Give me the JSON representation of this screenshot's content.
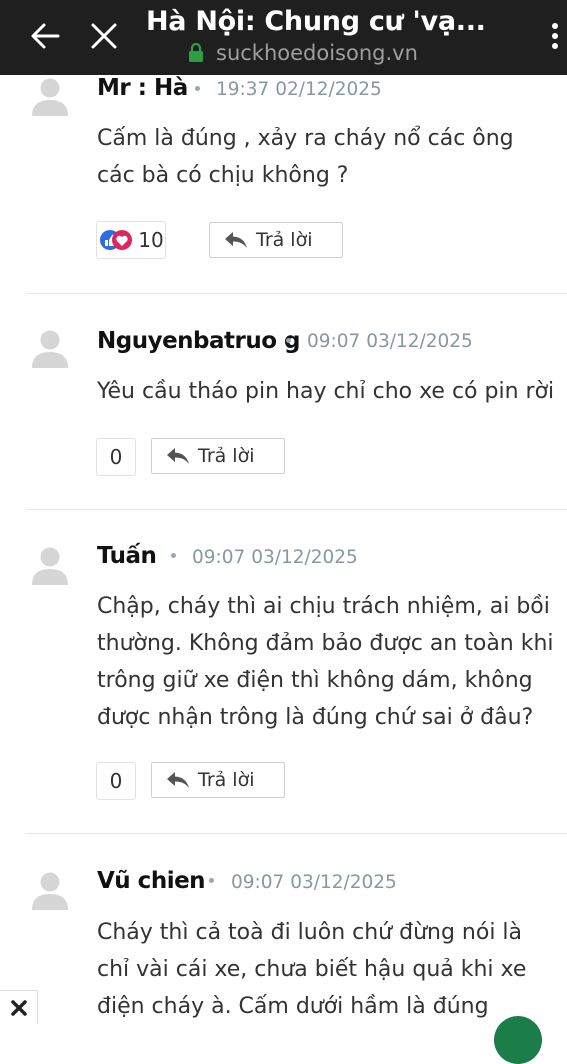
{
  "topbar": {
    "title": "Hà Nội: Chung cư 'vạ...",
    "url": "suckhoedoisong.vn",
    "back_icon": "arrow-left-icon",
    "close_icon": "close-icon",
    "menu_icon": "more-vert-icon",
    "lock_color": "#2e9e44"
  },
  "comments": [
    {
      "name": "Mr : Hà",
      "time": "19:37 02/12/2025",
      "text": "Cấm là đúng , xảy ra cháy nổ các ông các bà có chịu không ?",
      "reactions": "10",
      "reply": "Trả lời"
    },
    {
      "name": "Nguyenbatruo g",
      "time": "09:07 03/12/2025",
      "text": "Yêu cầu tháo pin hay chỉ cho xe có pin rời",
      "reactions": "0",
      "reply": "Trả lời"
    },
    {
      "name": "Tuấn",
      "time": "09:07 03/12/2025",
      "text": "Chập, cháy thì ai chịu trách nhiệm, ai bồi thường. Không đảm bảo được an toàn khi trông giữ xe điện thì không dám, không được nhận trông là đúng chứ sai ở đâu?",
      "reactions": "0",
      "reply": "Trả lời"
    },
    {
      "name": "Vũ chien",
      "time": "09:07 03/12/2025",
      "text": "Cháy thì cả toà đi luôn chứ đừng nói là chỉ vài cái xe, chưa biết hậu quả khi xe điện cháy à. Cấm dưới hầm là đúng"
    }
  ]
}
